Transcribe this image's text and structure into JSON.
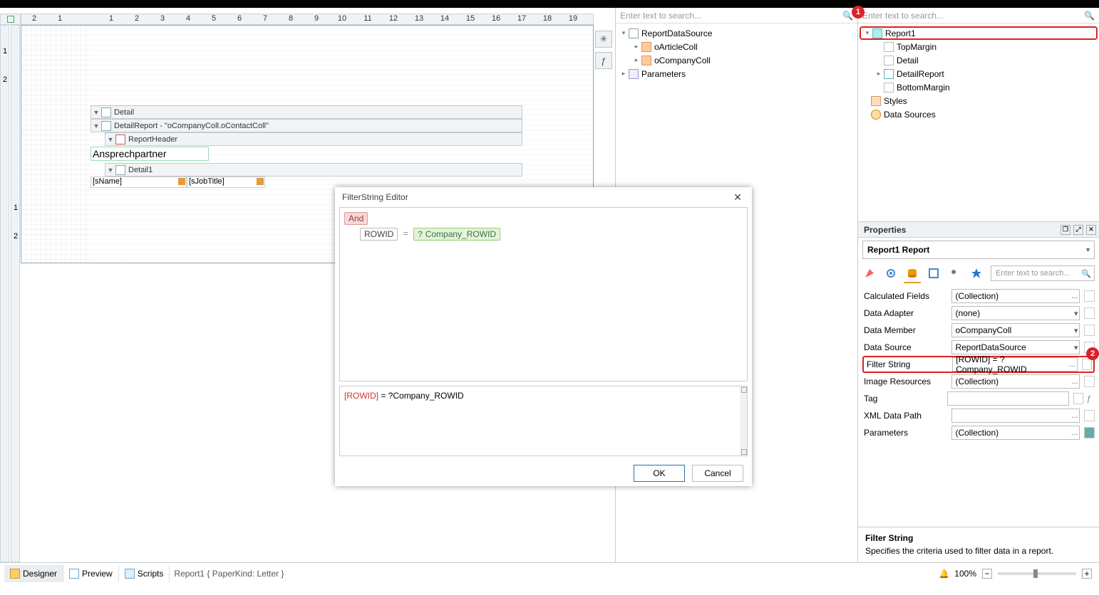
{
  "ruler": {
    "ticks": [
      "2",
      "1",
      "",
      "1",
      "2",
      "3",
      "4",
      "5",
      "6",
      "7",
      "8",
      "9",
      "10",
      "11",
      "12",
      "13",
      "14",
      "15",
      "16",
      "17",
      "18",
      "19"
    ]
  },
  "vruler": {
    "a": [
      "1",
      "2"
    ],
    "b": [
      "1",
      "2"
    ]
  },
  "sideTools": {
    "smart": "✳",
    "script": "ƒ"
  },
  "bands": {
    "detail": "Detail",
    "detailReport": "DetailReport - \"oCompanyColl.oContactColl\"",
    "reportHeader": "ReportHeader",
    "headerLabel": "Ansprechpartner",
    "detail1": "Detail1",
    "fields": [
      "[sName]",
      "[sJobTitle]"
    ]
  },
  "dialog": {
    "title": "FilterString Editor",
    "and": "And",
    "field": "ROWID",
    "op": "=",
    "param": "Company_ROWID",
    "exprField": "[ROWID]",
    "exprRest": " = ?Company_ROWID",
    "ok": "OK",
    "cancel": "Cancel"
  },
  "leftTree": {
    "searchPlaceholder": "Enter text to search...",
    "items": [
      {
        "indent": 0,
        "exp": "v",
        "icon": "ic-ds",
        "label": "ReportDataSource"
      },
      {
        "indent": 1,
        "exp": ">",
        "icon": "ic-tbl",
        "label": "oArticleColl"
      },
      {
        "indent": 1,
        "exp": ">",
        "icon": "ic-tbl",
        "label": "oCompanyColl"
      },
      {
        "indent": 0,
        "exp": ">",
        "icon": "ic-param",
        "label": "Parameters"
      }
    ]
  },
  "rightTree": {
    "searchPlaceholder": "Enter text to search...",
    "items": [
      {
        "indent": 0,
        "exp": "v",
        "icon": "ic-rpt",
        "label": "Report1",
        "hl": true
      },
      {
        "indent": 1,
        "exp": "",
        "icon": "ic-band",
        "label": "TopMargin"
      },
      {
        "indent": 1,
        "exp": "",
        "icon": "ic-band",
        "label": "Detail"
      },
      {
        "indent": 1,
        "exp": ">",
        "icon": "ic-det",
        "label": "DetailReport"
      },
      {
        "indent": 1,
        "exp": "",
        "icon": "ic-band",
        "label": "BottomMargin"
      },
      {
        "indent": 0,
        "exp": "",
        "icon": "ic-styles",
        "label": "Styles"
      },
      {
        "indent": 0,
        "exp": "",
        "icon": "ic-dsrc",
        "label": "Data Sources"
      }
    ]
  },
  "props": {
    "title": "Properties",
    "selector": "Report1   Report",
    "searchPlaceholder": "Enter text to search...",
    "rows": [
      {
        "name": "Calculated Fields",
        "value": "(Collection)",
        "btn": "..."
      },
      {
        "name": "Data Adapter",
        "value": "(none)",
        "btn": "▾"
      },
      {
        "name": "Data Member",
        "value": "oCompanyColl",
        "btn": "▾"
      },
      {
        "name": "Data Source",
        "value": "ReportDataSource",
        "btn": "▾"
      },
      {
        "name": "Filter String",
        "value": "[ROWID] = ?Company_ROWID",
        "btn": "...",
        "hl": true
      },
      {
        "name": "Image Resources",
        "value": "(Collection)",
        "btn": "..."
      },
      {
        "name": "Tag",
        "value": "",
        "btn": "",
        "fx": true
      },
      {
        "name": "XML Data Path",
        "value": "",
        "btn": "..."
      },
      {
        "name": "Parameters",
        "value": "(Collection)",
        "btn": "...",
        "resetFill": true
      }
    ],
    "desc": {
      "title": "Filter String",
      "text": "Specifies the criteria used to filter data in a report."
    }
  },
  "status": {
    "tabs": [
      {
        "icon": "ti-des",
        "label": "Designer",
        "active": true
      },
      {
        "icon": "ti-prev",
        "label": "Preview"
      },
      {
        "icon": "ti-scr",
        "label": "Scripts"
      }
    ],
    "crumb": "Report1 { PaperKind: Letter }",
    "zoom": "100%"
  },
  "badges": {
    "one": "1",
    "two": "2"
  }
}
